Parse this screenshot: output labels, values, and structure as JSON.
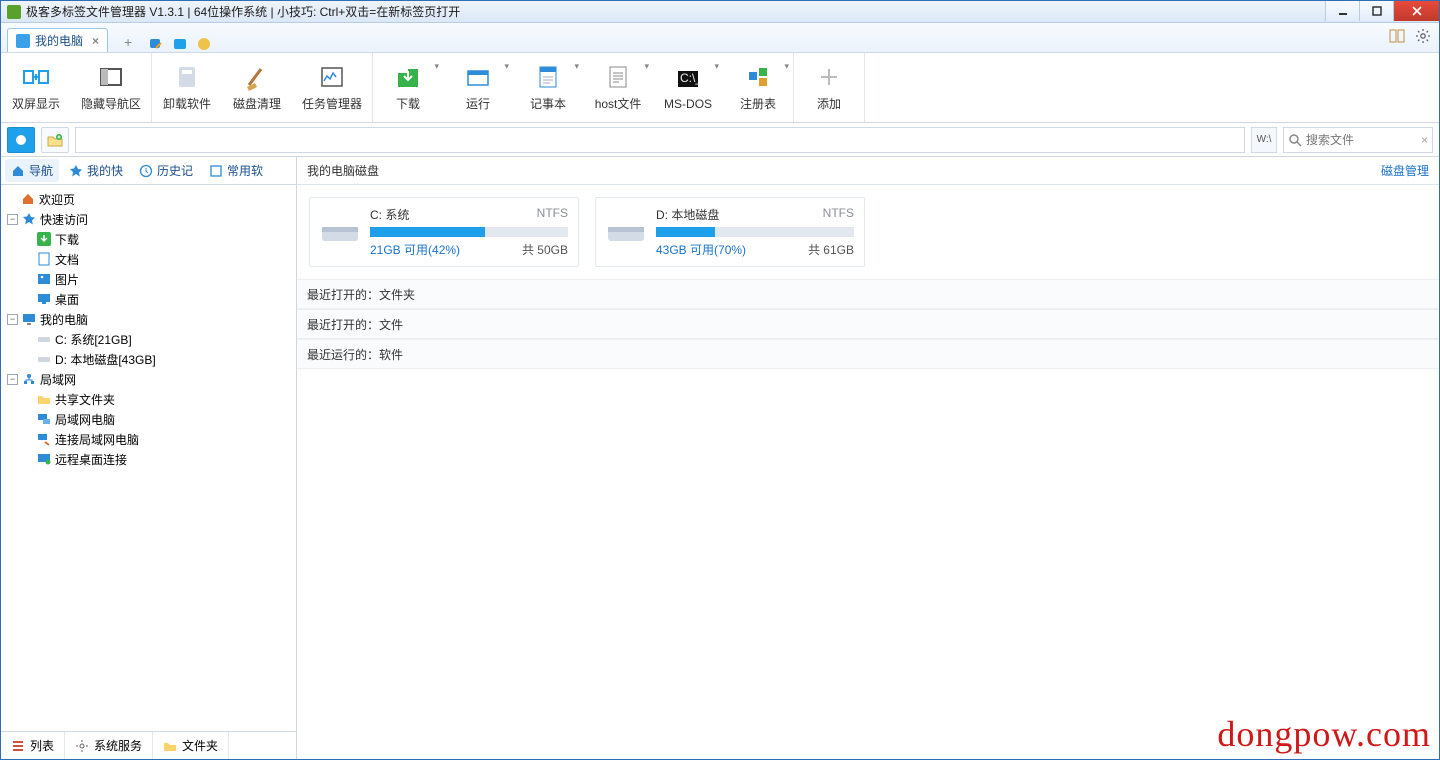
{
  "titlebar": {
    "text": "极客多标签文件管理器 V1.3.1  |  64位操作系统 | 小技巧: Ctrl+双击=在新标签页打开"
  },
  "tab": {
    "label": "我的电脑"
  },
  "ribbon": {
    "dual_screen": "双屏显示",
    "hide_nav": "隐藏导航区",
    "uninstall": "卸载软件",
    "disk_clean": "磁盘清理",
    "task_manager": "任务管理器",
    "download": "下载",
    "run": "运行",
    "notepad": "记事本",
    "hostfile": "host文件",
    "msdos": "MS-DOS",
    "registry": "注册表",
    "add": "添加"
  },
  "address": {
    "placeholder": "",
    "tag": "W:\\",
    "search_placeholder": "搜索文件"
  },
  "side_tabs": {
    "nav": "导航",
    "fav": "我的快",
    "history": "历史记",
    "common": "常用软"
  },
  "tree": {
    "welcome": "欢迎页",
    "quick": "快速访问",
    "downloads": "下载",
    "documents": "文档",
    "pictures": "图片",
    "desktop": "桌面",
    "mypc": "我的电脑",
    "drive_c": "C: 系统[21GB]",
    "drive_d": "D: 本地磁盘[43GB]",
    "lan": "局域网",
    "shared": "共享文件夹",
    "lan_pc": "局域网电脑",
    "connect_lan": "连接局域网电脑",
    "remote": "远程桌面连接"
  },
  "side_bottom": {
    "list": "列表",
    "services": "系统服务",
    "folder": "文件夹"
  },
  "main": {
    "header": "我的电脑磁盘",
    "manage_link": "磁盘管理"
  },
  "disks": [
    {
      "name": "C: 系统",
      "fs": "NTFS",
      "free": "21GB 可用(42%)",
      "total": "共 50GB",
      "pct": 58
    },
    {
      "name": "D: 本地磁盘",
      "fs": "NTFS",
      "free": "43GB 可用(70%)",
      "total": "共 61GB",
      "pct": 30
    }
  ],
  "sections": {
    "recent_folders": "最近打开的：文件夹",
    "recent_files": "最近打开的：文件",
    "recent_run": "最近运行的：软件"
  },
  "watermark": "dongpow.com"
}
